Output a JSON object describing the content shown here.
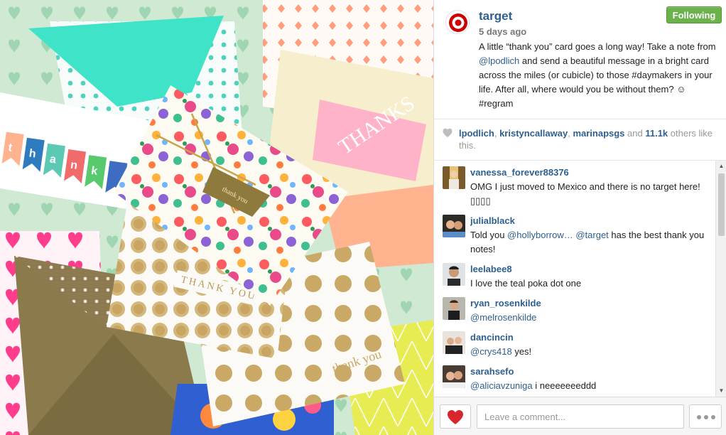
{
  "post": {
    "username": "target",
    "time_ago": "5 days ago",
    "follow_label": "Following",
    "caption": {
      "part1": "A little “thank you” card goes a long way! Take a note from ",
      "mention": "@lpodlich",
      "part2": " and send a beautiful message in a bright card across the miles (or cubicle) to those #daymakers in your life. After all, where would you be without them? ☺ #regram"
    }
  },
  "likes": {
    "user1": "lpodlich",
    "sep1": ", ",
    "user2": "kristyncallaway",
    "sep2": ", ",
    "user3": "marinapsgs",
    "and": " and ",
    "count": "11.1k",
    "suffix": " others like this."
  },
  "comments": [
    {
      "user": "vanessa_forever88376",
      "text": "OMG I just moved to Mexico and there is no target here! ▯▯▯▯"
    },
    {
      "user": "julialblack",
      "pre": "Told you ",
      "mention1": "@hollyborrow…",
      "mid": " ",
      "mention2": "@target",
      "post": " has the best thank you notes!"
    },
    {
      "user": "leelabee8",
      "text": "I love the teal poka dot one"
    },
    {
      "user": "ryan_rosenkilde",
      "mention": "@melrosenkilde"
    },
    {
      "user": "dancincin",
      "mention": "@crys418",
      "post": " yes!"
    },
    {
      "user": "sarahsefo",
      "mention": "@aliciavzuniga",
      "post": " i neeeeeeeddd"
    }
  ],
  "photo_text": {
    "thank_banner": [
      "t",
      "h",
      "a",
      "n",
      "k"
    ],
    "thanks": "THANKS",
    "thank_you_1": "thank you",
    "thank_you_2": "THANK YOU",
    "thank_you_3": "thank you"
  },
  "composer": {
    "placeholder": "Leave a comment..."
  },
  "colors": {
    "link": "#2d5f8f",
    "follow_green": "#6bb24b",
    "target_red": "#cc0000",
    "heart_red": "#d7262d"
  },
  "icons": {
    "like": "heart-icon",
    "more": "ellipsis-icon",
    "logo": "target-logo"
  }
}
